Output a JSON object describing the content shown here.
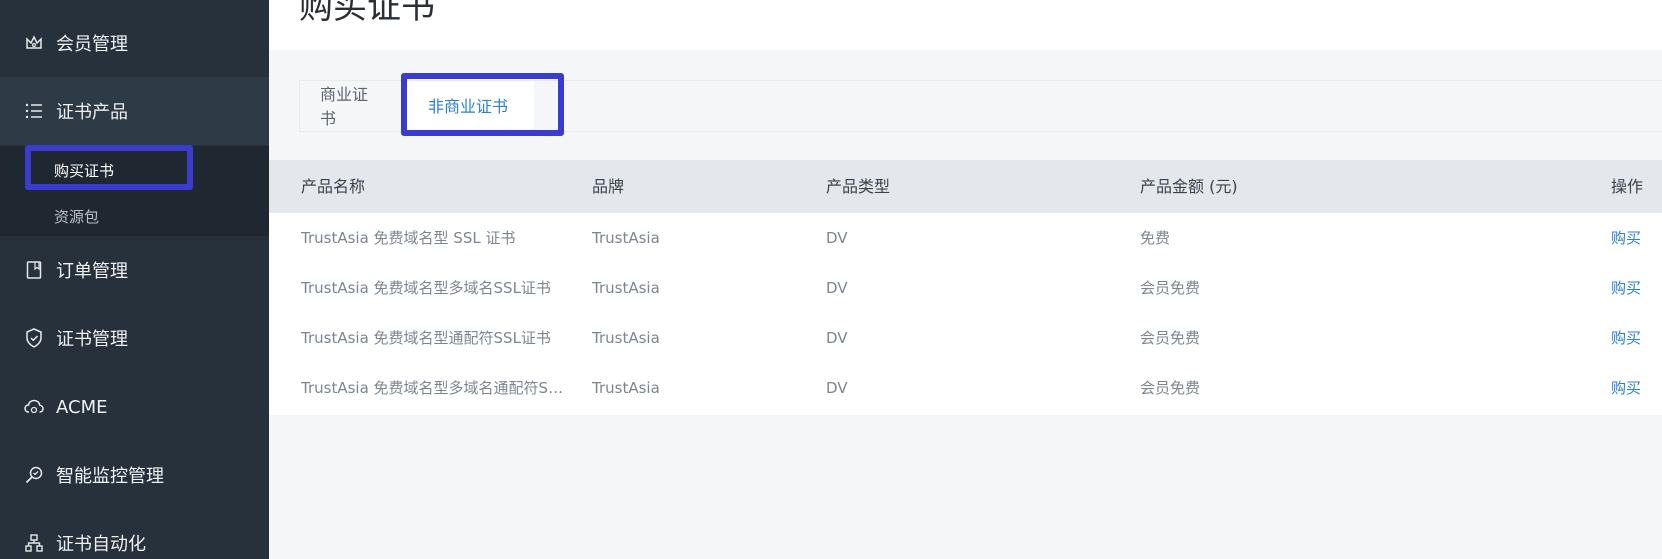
{
  "sidebar": {
    "items": [
      {
        "label": "会员管理",
        "icon": "crown-icon"
      },
      {
        "label": "证书产品",
        "icon": "list-icon"
      },
      {
        "label": "订单管理",
        "icon": "bookmark-icon"
      },
      {
        "label": "证书管理",
        "icon": "shield-check-icon"
      },
      {
        "label": "ACME",
        "icon": "cloud-sync-icon"
      },
      {
        "label": "智能监控管理",
        "icon": "search-monitor-icon"
      },
      {
        "label": "证书自动化",
        "icon": "org-chart-icon"
      }
    ],
    "subitems": [
      {
        "label": "购买证书"
      },
      {
        "label": "资源包"
      }
    ]
  },
  "page": {
    "title": "购买证书"
  },
  "tabs": [
    {
      "label": "商业证书"
    },
    {
      "label": "非商业证书"
    }
  ],
  "table": {
    "columns": [
      "产品名称",
      "品牌",
      "产品类型",
      "产品金额 (元)",
      "操作"
    ],
    "rows": [
      {
        "name": "TrustAsia 免费域名型 SSL 证书",
        "brand": "TrustAsia",
        "type": "DV",
        "price": "免费",
        "action": "购买"
      },
      {
        "name": "TrustAsia 免费域名型多域名SSL证书",
        "brand": "TrustAsia",
        "type": "DV",
        "price": "会员免费",
        "action": "购买"
      },
      {
        "name": "TrustAsia 免费域名型通配符SSL证书",
        "brand": "TrustAsia",
        "type": "DV",
        "price": "会员免费",
        "action": "购买"
      },
      {
        "name": "TrustAsia 免费域名型多域名通配符SS...",
        "brand": "TrustAsia",
        "type": "DV",
        "price": "会员免费",
        "action": "购买"
      }
    ]
  },
  "colors": {
    "sidebar_bg": "#26313b",
    "accent": "#2a7de1",
    "highlight": "#3a3ccf"
  }
}
